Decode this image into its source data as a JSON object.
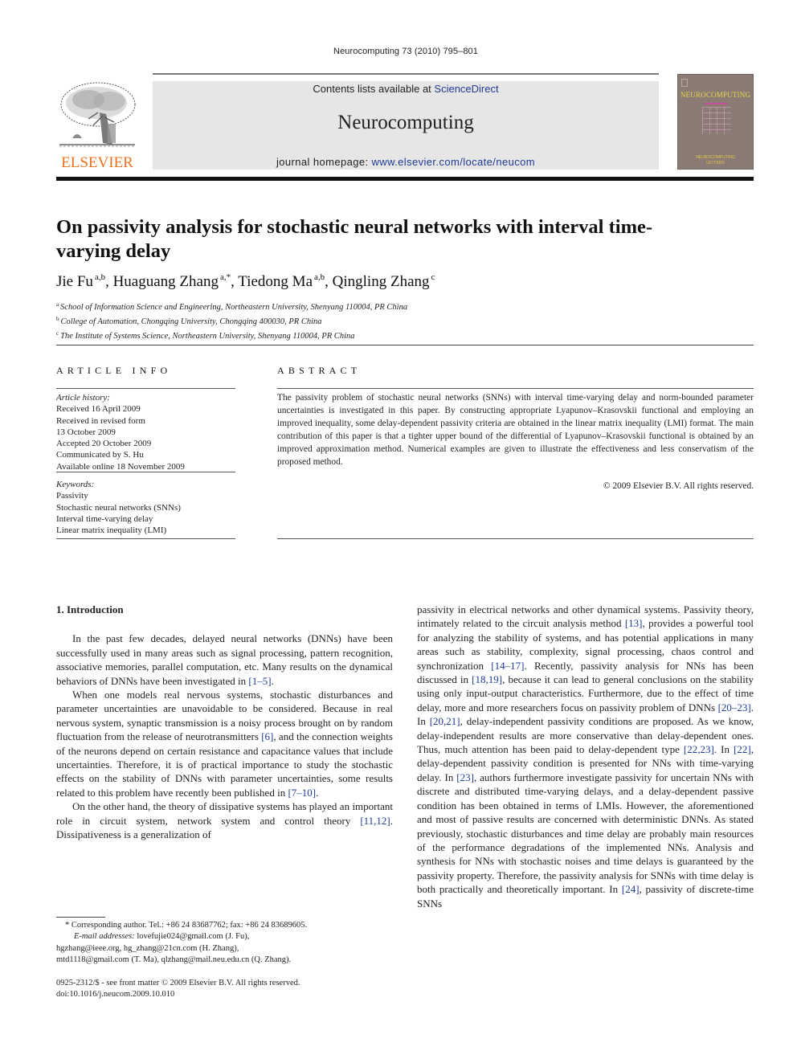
{
  "running_head": "Neurocomputing 73 (2010) 795–801",
  "masthead": {
    "contents_prefix": "Contents lists available at ",
    "contents_link": "ScienceDirect",
    "journal_name": "Neurocomputing",
    "homepage_prefix": "journal homepage: ",
    "homepage_link": "www.elsevier.com/locate/neucom"
  },
  "publisher_logo": {
    "text": "ELSEVIER",
    "color": "#e8731c",
    "icon": "elsevier-tree-icon"
  },
  "cover": {
    "title": "NEUROCOMPUTING",
    "foot_line1": "NEUROCOMPUTING",
    "foot_line2": "LETTERS"
  },
  "article": {
    "title": "On passivity analysis for stochastic neural networks with interval time-varying delay",
    "authors": [
      {
        "name": "Jie Fu",
        "sup": "a,b",
        "sep": ", "
      },
      {
        "name": "Huaguang Zhang",
        "sup": "a,*",
        "sep": ", "
      },
      {
        "name": "Tiedong Ma",
        "sup": "a,b",
        "sep": ", "
      },
      {
        "name": "Qingling Zhang",
        "sup": "c",
        "sep": ""
      }
    ],
    "affiliations": [
      {
        "key": "a",
        "text": "School of Information Science and Engineering, Northeastern University, Shenyang 110004, PR China"
      },
      {
        "key": "b",
        "text": "College of Automation, Chongqing University, Chongqing 400030, PR China"
      },
      {
        "key": "c",
        "text": "The Institute of Systems Science, Northeastern University, Shenyang 110004, PR China"
      }
    ]
  },
  "article_info": {
    "heading": "ARTICLE INFO",
    "history_label": "Article history:",
    "history": [
      "Received 16 April 2009",
      "Received in revised form",
      "13 October 2009",
      "Accepted 20 October 2009",
      "Communicated by S. Hu",
      "Available online 18 November 2009"
    ],
    "keywords_label": "Keywords:",
    "keywords": [
      "Passivity",
      "Stochastic neural networks (SNNs)",
      "Interval time-varying delay",
      "Linear matrix inequality (LMI)"
    ]
  },
  "abstract": {
    "heading": "ABSTRACT",
    "text": "The passivity problem of stochastic neural networks (SNNs) with interval time-varying delay and norm-bounded parameter uncertainties is investigated in this paper. By constructing appropriate Lyapunov–Krasovskii functional and employing an improved inequality, some delay-dependent passivity criteria are obtained in the linear matrix inequality (LMI) format. The main contribution of this paper is that a tighter upper bound of the differential of Lyapunov–Krasovskii functional is obtained by an improved approximation method. Numerical examples are given to illustrate the effectiveness and less conservatism of the proposed method.",
    "copyright": "© 2009 Elsevier B.V. All rights reserved."
  },
  "body": {
    "section_heading": "1.  Introduction",
    "left_paragraphs": [
      [
        {
          "t": "In the past few decades, delayed neural networks (DNNs) have been successfully used in many areas such as signal processing, pattern recognition, associative memories, parallel computation, etc. Many results on the dynamical behaviors of DNNs have been investigated in "
        },
        {
          "c": "[1–5]"
        },
        {
          "t": "."
        }
      ],
      [
        {
          "t": "When one models real nervous systems, stochastic disturbances and parameter uncertainties are unavoidable to be considered. Because in real nervous system, synaptic transmission is a noisy process brought on by random fluctuation from the release of neurotransmitters "
        },
        {
          "c": "[6]"
        },
        {
          "t": ", and the connection weights of the neurons depend on certain resistance and capacitance values that include uncertainties. Therefore, it is of practical importance to study the stochastic effects on the stability of DNNs with parameter uncertainties, some results related to this problem have recently been published in "
        },
        {
          "c": "[7–10]"
        },
        {
          "t": "."
        }
      ],
      [
        {
          "t": "On the other hand, the theory of dissipative systems has played an important role in circuit system, network system and control theory "
        },
        {
          "c": "[11,12]"
        },
        {
          "t": ". Dissipativeness is a generalization of"
        }
      ]
    ],
    "right_paragraph": [
      {
        "t": "passivity in electrical networks and other dynamical systems. Passivity theory, intimately related to the circuit analysis method "
      },
      {
        "c": "[13]"
      },
      {
        "t": ", provides a powerful tool for analyzing the stability of systems, and has potential applications in many areas such as stability, complexity, signal processing, chaos control and synchronization "
      },
      {
        "c": "[14–17]"
      },
      {
        "t": ". Recently, passivity analysis for NNs has been discussed in "
      },
      {
        "c": "[18,19]"
      },
      {
        "t": ", because it can lead to general conclusions on the stability using only input-output characteristics. Furthermore, due to the effect of time delay, more and more researchers focus on passivity problem of DNNs "
      },
      {
        "c": "[20–23]"
      },
      {
        "t": ". In "
      },
      {
        "c": "[20,21]"
      },
      {
        "t": ", delay-independent passivity conditions are proposed. As we know, delay-independent results are more conservative than delay-dependent ones. Thus, much attention has been paid to delay-dependent type "
      },
      {
        "c": "[22,23]"
      },
      {
        "t": ". In "
      },
      {
        "c": "[22]"
      },
      {
        "t": ", delay-dependent passivity condition is presented for NNs with time-varying delay. In "
      },
      {
        "c": "[23]"
      },
      {
        "t": ", authors furthermore investigate passivity for uncertain NNs with discrete and distributed time-varying delays, and a delay-dependent passive condition has been obtained in terms of LMIs. However, the aforementioned and most of passive results are concerned with deterministic DNNs. As stated previously, stochastic disturbances and time delay are probably main resources of the performance degradations of the implemented NNs. Analysis and synthesis for NNs with stochastic noises and time delays is guaranteed by the passivity property. Therefore, the passivity analysis for SNNs with time delay is both practically and theoretically important. In "
      },
      {
        "c": "[24]"
      },
      {
        "t": ", passivity of discrete-time SNNs"
      }
    ]
  },
  "footnote": {
    "corresponding": "* Corresponding author. Tel.: +86 24 83687762; fax: +86 24 83689605.",
    "email_label": "E-mail addresses:",
    "email_line1": " lovefujie024@gmail.com (J. Fu),",
    "email_line2": "hgzhang@ieee.org, hg_zhang@21cn.com (H. Zhang),",
    "email_line3": "mtd1118@gmail.com (T. Ma), qlzhang@mail.neu.edu.cn (Q. Zhang)."
  },
  "front_matter": {
    "issn_line": "0925-2312/$ - see front matter © 2009 Elsevier B.V. All rights reserved.",
    "doi": "doi:10.1016/j.neucom.2009.10.010"
  }
}
